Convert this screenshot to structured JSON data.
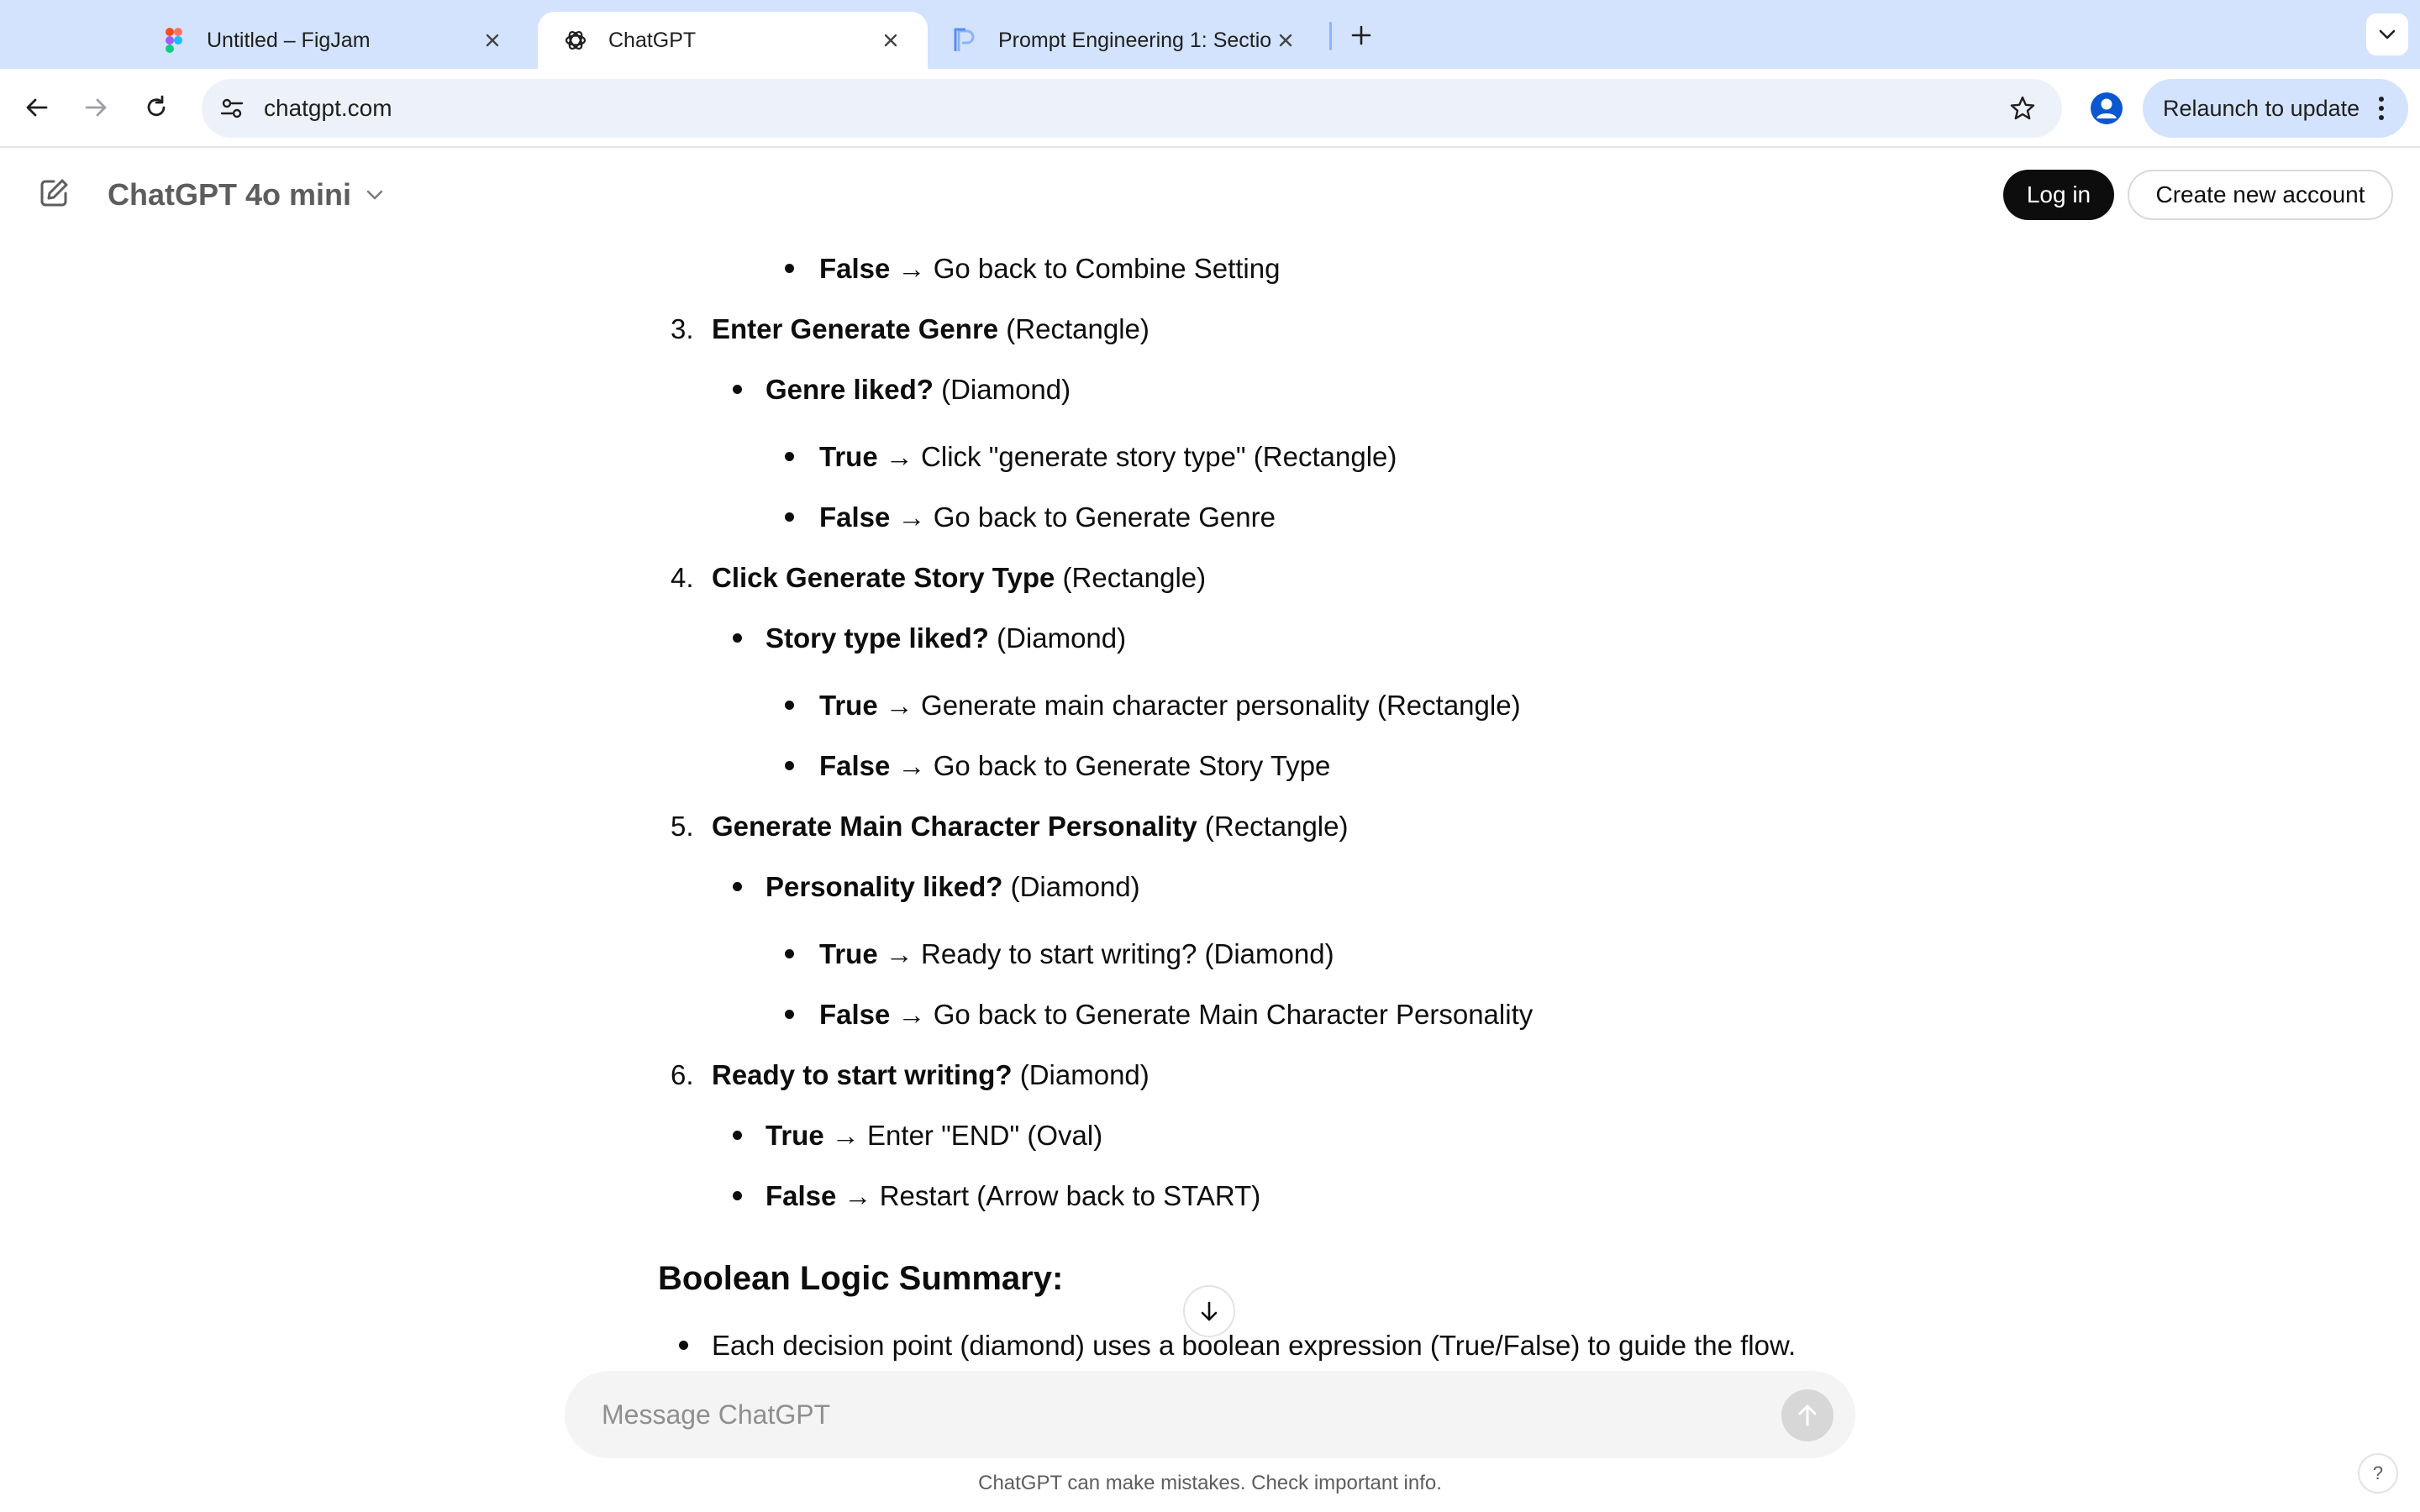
{
  "browser": {
    "tabs": [
      {
        "title": "Untitled – FigJam",
        "favicon": "figma-icon",
        "active": false
      },
      {
        "title": "ChatGPT",
        "favicon": "openai-icon",
        "active": true
      },
      {
        "title": "Prompt Engineering 1: Section",
        "favicon": "pp-icon",
        "active": false
      }
    ],
    "url": "chatgpt.com",
    "relaunch_label": "Relaunch to update"
  },
  "header": {
    "model_name": "ChatGPT 4o mini",
    "login_label": "Log in",
    "signup_label": "Create new account"
  },
  "content": {
    "l1_bold": "False",
    "l1_text": " → Go back to Combine Setting",
    "s3_num": "3.",
    "s3_bold": "Enter Generate Genre",
    "s3_text": " (Rectangle)",
    "s3_q_bold": "Genre liked?",
    "s3_q_text": " (Diamond)",
    "s3_t_bold": "True",
    "s3_t_text": " → Click \"generate story type\" (Rectangle)",
    "s3_f_bold": "False",
    "s3_f_text": " → Go back to Generate Genre",
    "s4_num": "4.",
    "s4_bold": "Click Generate Story Type",
    "s4_text": " (Rectangle)",
    "s4_q_bold": "Story type liked?",
    "s4_q_text": " (Diamond)",
    "s4_t_bold": "True",
    "s4_t_text": " → Generate main character personality (Rectangle)",
    "s4_f_bold": "False",
    "s4_f_text": " → Go back to Generate Story Type",
    "s5_num": "5.",
    "s5_bold": "Generate Main Character Personality",
    "s5_text": " (Rectangle)",
    "s5_q_bold": "Personality liked?",
    "s5_q_text": " (Diamond)",
    "s5_t_bold": "True",
    "s5_t_text": " → Ready to start writing? (Diamond)",
    "s5_f_bold": "False",
    "s5_f_text": " → Go back to Generate Main Character Personality",
    "s6_num": "6.",
    "s6_bold": "Ready to start writing?",
    "s6_text": " (Diamond)",
    "s6_t_bold": "True",
    "s6_t_text": " → Enter \"END\" (Oval)",
    "s6_f_bold": "False",
    "s6_f_text": " → Restart (Arrow back to START)",
    "summary_heading": "Boolean Logic Summary:",
    "summary_item": "Each decision point (diamond) uses a boolean expression (True/False) to guide the flow."
  },
  "composer": {
    "placeholder": "Message ChatGPT",
    "disclaimer": "ChatGPT can make mistakes. Check important info.",
    "help_label": "?"
  }
}
